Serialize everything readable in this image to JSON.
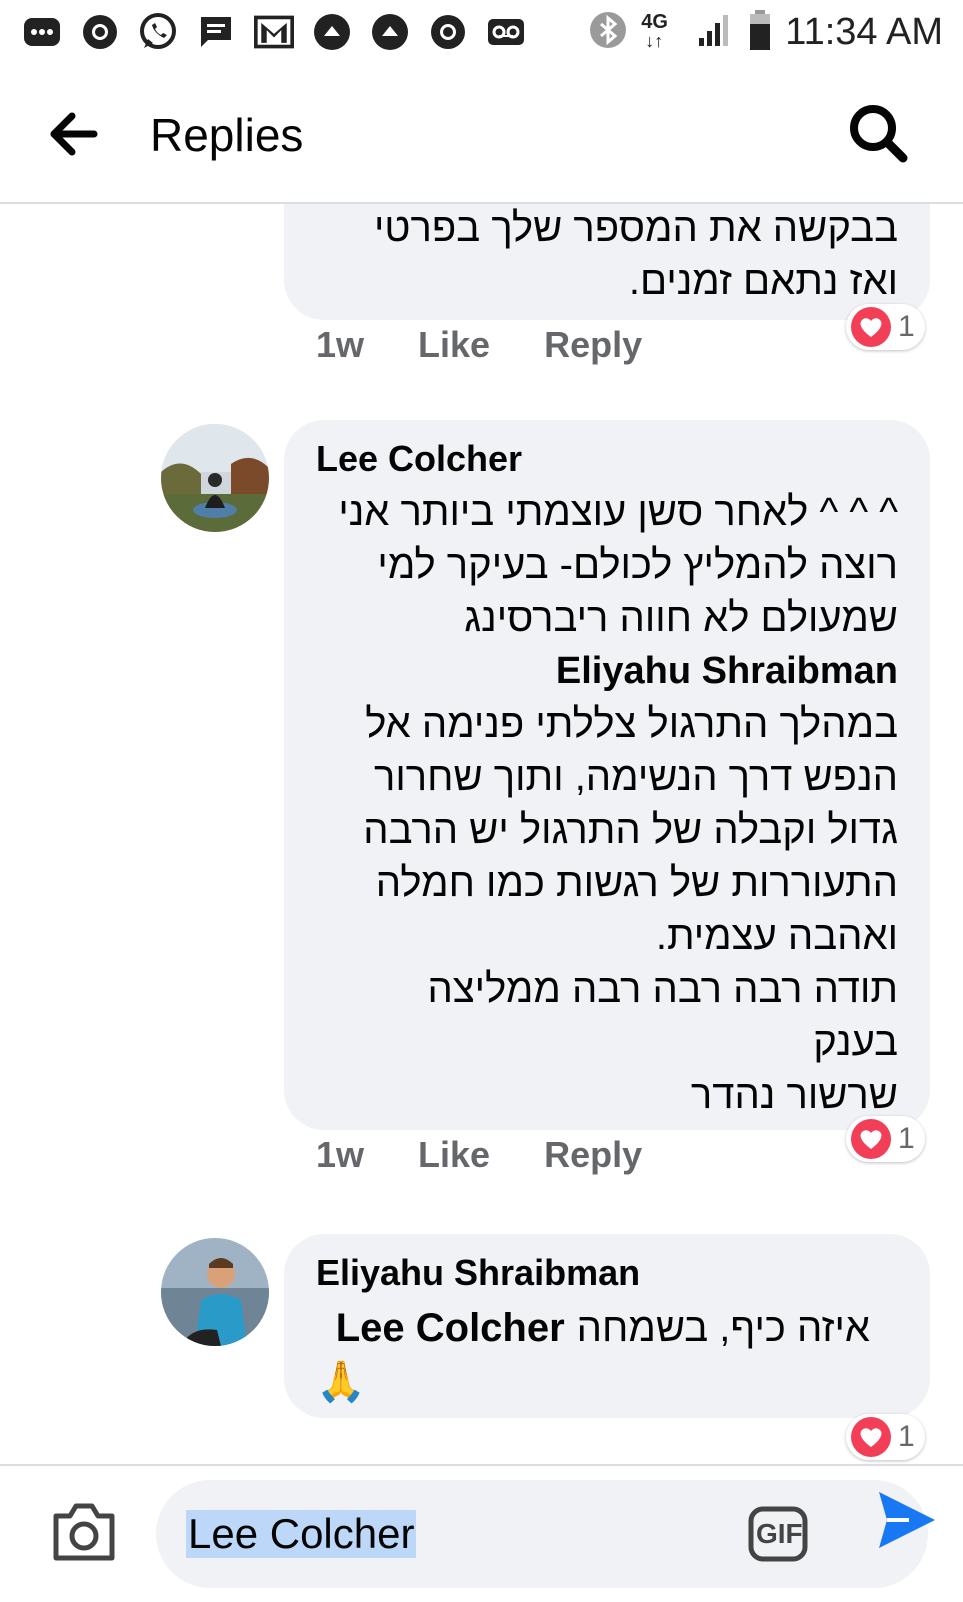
{
  "status_bar": {
    "time": "11:34 AM",
    "network": "4G",
    "icons": [
      "messages-icon",
      "chrome-icon",
      "whatsapp-icon",
      "sms-icon",
      "gmail-icon",
      "upload-icon",
      "upload-icon",
      "chrome-icon",
      "voicemail-icon",
      "bluetooth-icon",
      "signal-icon",
      "battery-icon"
    ]
  },
  "header": {
    "title": "Replies"
  },
  "comments": [
    {
      "text_lines": [
        "בבקשה את המספר שלך בפרטי",
        "ואז נתאם זמנים."
      ],
      "time": "1w",
      "like": "Like",
      "reply": "Reply",
      "reactions": "1"
    },
    {
      "author": "Lee Colcher",
      "text_lines": [
        "^ ^ ^ לאחר סשן עוצמתי ביותר אני",
        "רוצה להמליץ לכולם- בעיקר למי",
        "שמעולם לא חווה ריברסינג"
      ],
      "mention": "Eliyahu Shraibman",
      "text_lines_2": [
        "במהלך התרגול צללתי פנימה אל",
        "הנפש דרך הנשימה, ותוך שחרור",
        "גדול וקבלה של התרגול יש הרבה",
        "התעוררות של רגשות כמו חמלה",
        "ואהבה עצמית.",
        "תודה רבה רבה רבה ממליצה",
        "בענק",
        "שרשור נהדר"
      ],
      "time": "1w",
      "like": "Like",
      "reply": "Reply",
      "reactions": "1"
    },
    {
      "author": "Eliyahu Shraibman",
      "text": "איזה כיף, בשמחה",
      "mention": "Lee Colcher",
      "emoji": "🙏",
      "reactions": "1"
    }
  ],
  "composer": {
    "input_value": "Lee Colcher",
    "gif_label": "GIF"
  },
  "colors": {
    "bubble": "#f0f2f5",
    "accent": "#1877f2",
    "secondary_text": "#65676b",
    "love": "#f33e58"
  }
}
